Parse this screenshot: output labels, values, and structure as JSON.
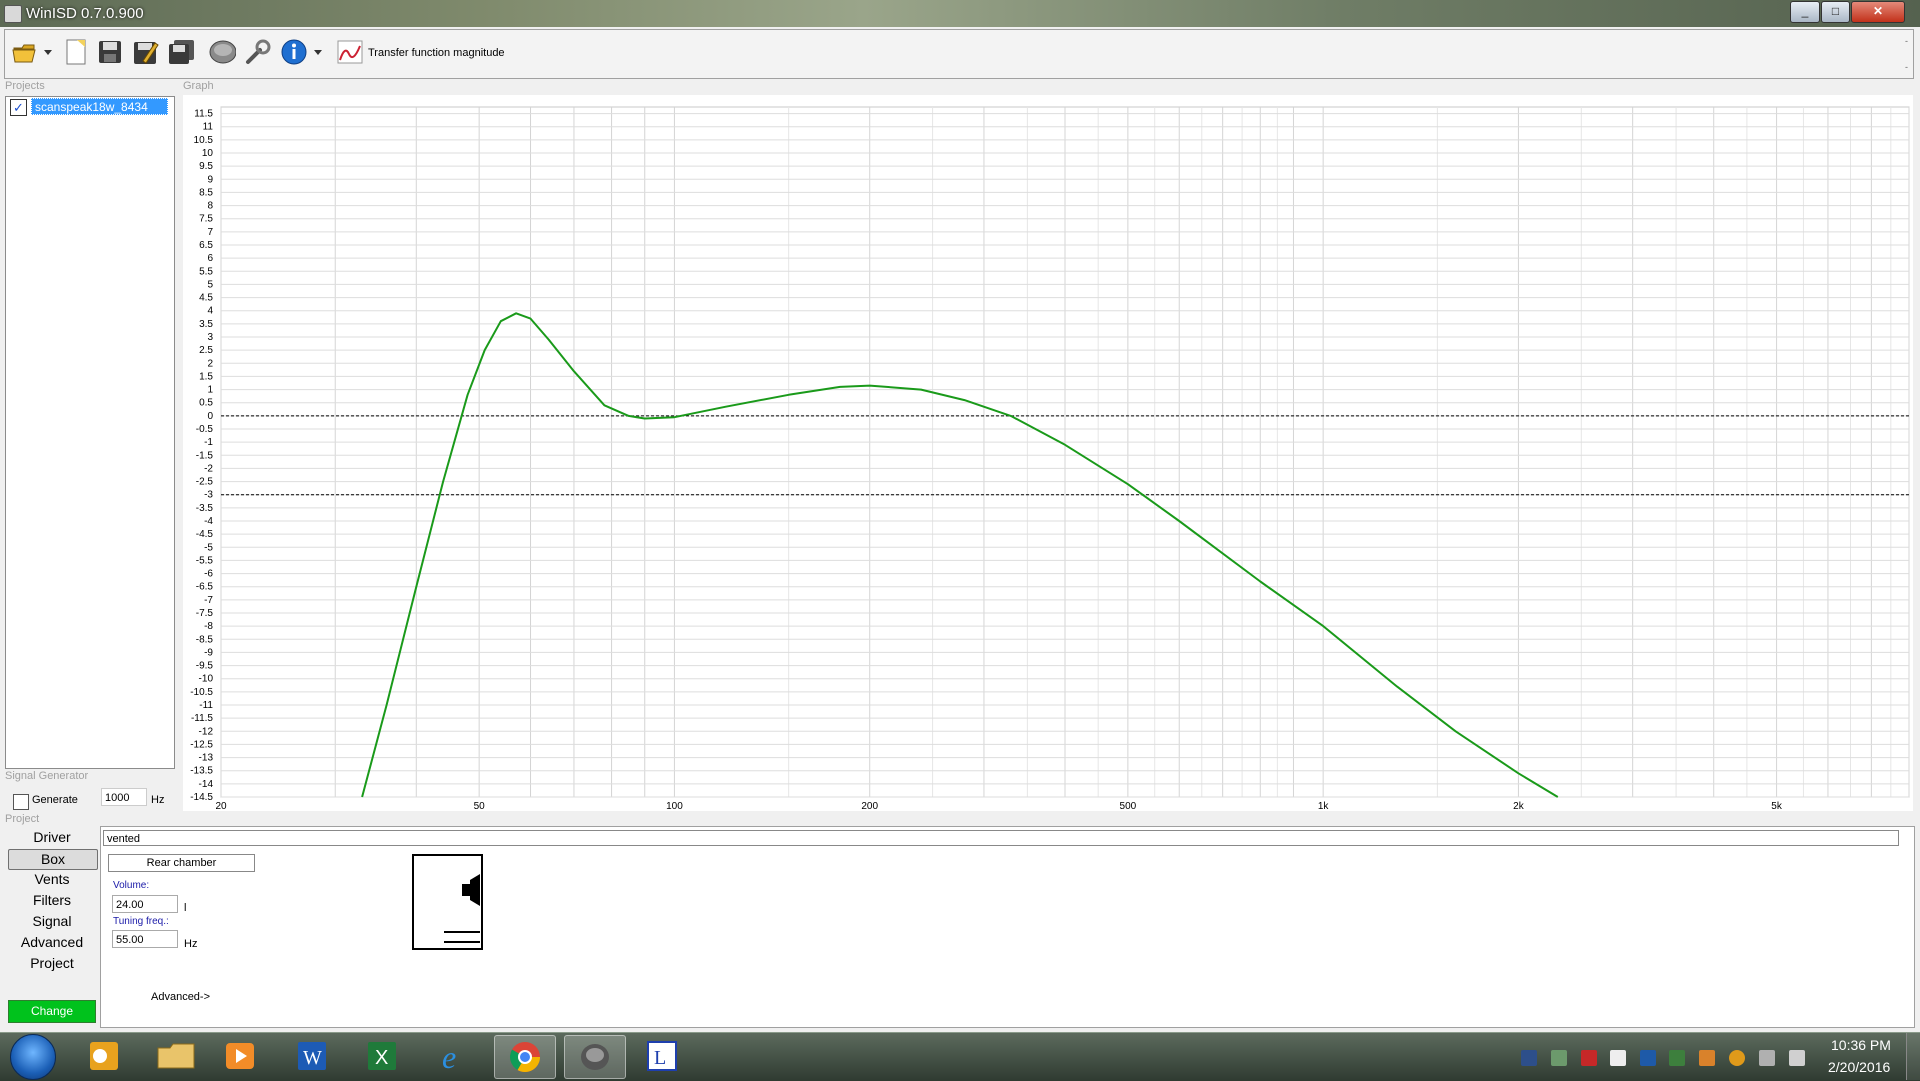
{
  "window": {
    "title": "WinISD 0.7.0.900",
    "minimize": "_",
    "maximize": "□",
    "close": "✕"
  },
  "toolbar": {
    "tf_label": "Transfer function magnitude"
  },
  "sections": {
    "projects": "Projects",
    "graph": "Graph",
    "signal_generator": "Signal Generator",
    "project": "Project"
  },
  "projects": [
    {
      "name": "scanspeak18w_8434",
      "checked": true
    }
  ],
  "signal": {
    "generate_label": "Generate",
    "frequency": "1000",
    "unit": "Hz"
  },
  "nav": {
    "items": [
      "Driver",
      "Box",
      "Vents",
      "Filters",
      "Signal",
      "Advanced",
      "Project"
    ],
    "active": "Box",
    "change_label": "Change"
  },
  "box": {
    "type": "vented",
    "rear_chamber": "Rear chamber",
    "volume_label": "Volume:",
    "volume": "24.00",
    "volume_unit": "l",
    "tuning_label": "Tuning freq.:",
    "tuning": "55.00",
    "tuning_unit": "Hz",
    "advanced": "Advanced->"
  },
  "chart_data": {
    "type": "line",
    "xscale": "log",
    "xlim": [
      20,
      8000
    ],
    "ylim": [
      -14.5,
      11.75
    ],
    "x_ticks": [
      20,
      50,
      100,
      200,
      500,
      1000,
      2000,
      5000
    ],
    "x_tick_labels": [
      "20",
      "50",
      "100",
      "200",
      "500",
      "1k",
      "2k",
      "5k"
    ],
    "y_ticks": [
      11.5,
      11,
      10.5,
      10,
      9.5,
      9,
      8.5,
      8,
      7.5,
      7,
      6.5,
      6,
      5.5,
      5,
      4.5,
      4,
      3.5,
      3,
      2.5,
      2,
      1.5,
      1,
      0.5,
      0,
      -0.5,
      -1,
      -1.5,
      -2,
      -2.5,
      -3,
      -3.5,
      -4,
      -4.5,
      -5,
      -5.5,
      -6,
      -6.5,
      -7,
      -7.5,
      -8,
      -8.5,
      -9,
      -9.5,
      -10,
      -10.5,
      -11,
      -11.5,
      -12,
      -12.5,
      -13,
      -13.5,
      -14,
      -14.5
    ],
    "y_tick_labels": [
      "11.5",
      "11",
      "10.5",
      "10",
      "9.5",
      "9",
      "8.5",
      "8",
      "7.5",
      "7",
      "6.5",
      "6",
      "5.5",
      "5",
      "4.5",
      "4",
      "3.5",
      "3",
      "2.5",
      "2",
      "1.5",
      "1",
      "0.5",
      "0",
      "-0.5",
      "-1",
      "-1.5",
      "-2",
      "-2.5",
      "-3",
      "-3.5",
      "-4",
      "-4.5",
      "-5",
      "-5.5",
      "-6",
      "-6.5",
      "-7",
      "-7.5",
      "-8",
      "-8.5",
      "-9",
      "-9.5",
      "-10",
      "-10.5",
      "-11",
      "-11.5",
      "-12",
      "-12.5",
      "-13",
      "-13.5",
      "-14",
      "-14.5"
    ],
    "reference_lines": [
      0,
      -3
    ],
    "grid": true,
    "series": [
      {
        "color": "#1a9a1a",
        "x": [
          33,
          36,
          40,
          44,
          48,
          51,
          54,
          57,
          60,
          64,
          70,
          78,
          85,
          90,
          100,
          120,
          150,
          180,
          200,
          240,
          280,
          330,
          400,
          500,
          600,
          800,
          1000,
          1300,
          1600,
          2000,
          2300
        ],
        "y": [
          -14.5,
          -11,
          -6.5,
          -2.5,
          0.8,
          2.5,
          3.6,
          3.9,
          3.7,
          2.9,
          1.7,
          0.4,
          0,
          -0.1,
          -0.05,
          0.35,
          0.8,
          1.1,
          1.15,
          1.0,
          0.6,
          0,
          -1.1,
          -2.6,
          -4.0,
          -6.3,
          -8.0,
          -10.3,
          -12.0,
          -13.6,
          -14.5
        ]
      }
    ]
  }
}
